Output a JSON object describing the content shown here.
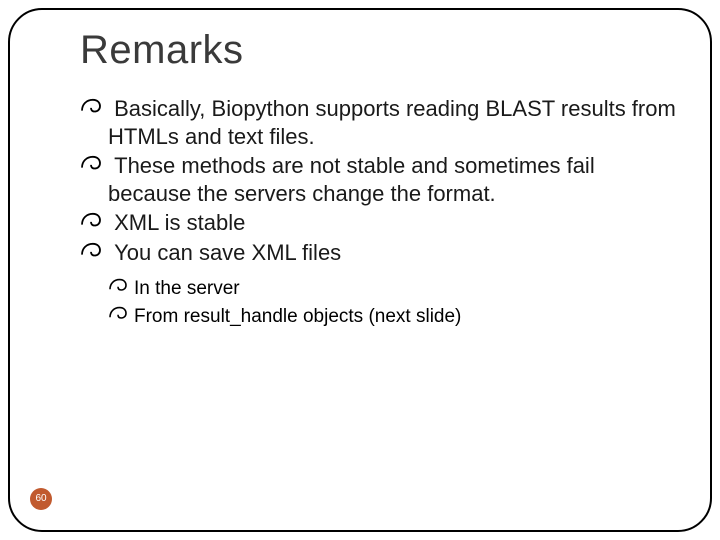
{
  "slide": {
    "title": "Remarks",
    "bullets": [
      "Basically, Biopython supports reading BLAST results from HTMLs and text files.",
      "These methods are not stable and sometimes fail because the servers change the format.",
      "XML is stable",
      "You can save XML files"
    ],
    "sub_bullets": [
      "In the server",
      "From result_handle objects (next slide)"
    ],
    "page_number": "60"
  }
}
